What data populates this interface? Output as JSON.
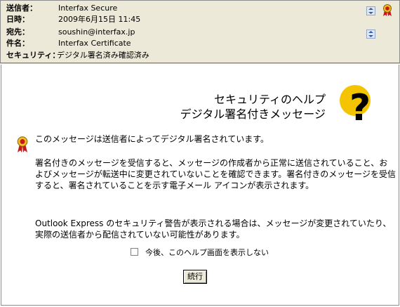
{
  "header": {
    "from_label": "送信者：",
    "from_value": "Interfax Secure",
    "date_label": "日時：",
    "date_value": "2009年6月15日 11:45",
    "to_label": "宛先：",
    "to_value": "soushin@interfax.jp",
    "subject_label": "件名：",
    "subject_value": "Interfax Certificate",
    "security_label": "セキュリティ：",
    "security_value": "デジタル署名済み確認済み"
  },
  "help": {
    "title_line1": "セキュリティのヘルプ",
    "title_line2": "デジタル署名付きメッセージ",
    "intro": "このメッセージは送信者によってデジタル署名されています。",
    "paragraph1": "署名付きのメッセージを受信すると、メッセージの作成者から正常に送信されていること、およびメッセージが転送中に変更されていないことを確認できます。署名付きのメッセージを受信すると、署名されていることを示す電子メール アイコンが表示されます。",
    "paragraph2": "Outlook Express のセキュリティ警告が表示される場合は、メッセージが変更されていたり、実際の送信者から配信されていない可能性があります。",
    "dont_show_label": "今後、このヘルプ画面を表示しない",
    "continue_label": "続行"
  },
  "icons": {
    "certificate": "certificate-seal-icon",
    "help": "question-mark-icon",
    "scroll": "scroll-arrows-icon"
  },
  "colors": {
    "header_bg": "#ece9d8",
    "seal_red": "#c81818",
    "seal_gold": "#f0c020",
    "help_yellow": "#f5c400"
  }
}
